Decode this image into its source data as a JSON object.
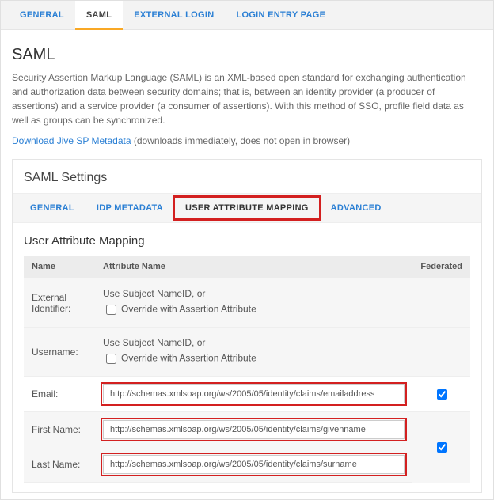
{
  "top_tabs": {
    "general": "GENERAL",
    "saml": "SAML",
    "external_login": "EXTERNAL LOGIN",
    "login_entry": "LOGIN ENTRY PAGE"
  },
  "page_title": "SAML",
  "description": "Security Assertion Markup Language (SAML) is an XML-based open standard for exchanging authentication and authorization data between security domains; that is, between an identity provider (a producer of assertions) and a service provider (a consumer of assertions). With this method of SSO, profile field data as well as groups can be synchronized.",
  "download_link": "Download Jive SP Metadata",
  "download_note": "(downloads immediately, does not open in browser)",
  "settings_title": "SAML Settings",
  "sub_tabs": {
    "general": "GENERAL",
    "idp": "IDP METADATA",
    "uam": "USER ATTRIBUTE MAPPING",
    "advanced": "ADVANCED"
  },
  "section_heading": "User Attribute Mapping",
  "columns": {
    "name": "Name",
    "attribute": "Attribute Name",
    "federated": "Federated"
  },
  "rows": {
    "external_id": {
      "name": "External Identifier:",
      "option1": "Use Subject NameID, or",
      "option2": "Override with Assertion Attribute"
    },
    "username": {
      "name": "Username:",
      "option1": "Use Subject NameID, or",
      "option2": "Override with Assertion Attribute"
    },
    "email": {
      "name": "Email:",
      "value": "http://schemas.xmlsoap.org/ws/2005/05/identity/claims/emailaddress",
      "federated": true
    },
    "first_name": {
      "name": "First Name:",
      "value": "http://schemas.xmlsoap.org/ws/2005/05/identity/claims/givenname"
    },
    "last_name": {
      "name": "Last Name:",
      "value": "http://schemas.xmlsoap.org/ws/2005/05/identity/claims/surname",
      "federated": true
    }
  }
}
